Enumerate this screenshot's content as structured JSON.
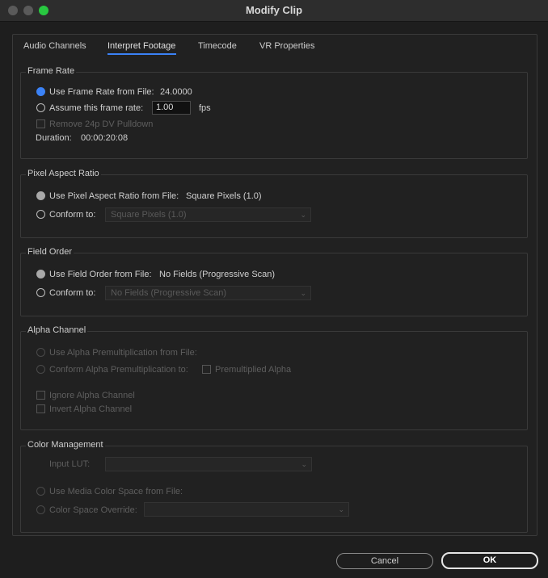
{
  "window": {
    "title": "Modify Clip"
  },
  "tabs": [
    "Audio Channels",
    "Interpret Footage",
    "Timecode",
    "VR Properties"
  ],
  "frame_rate": {
    "label": "Frame Rate",
    "use_from_file": "Use Frame Rate from File:",
    "file_value": "24.0000",
    "assume": "Assume this frame rate:",
    "assume_value": "1.00",
    "unit": "fps",
    "remove_pulldown": "Remove 24p DV Pulldown",
    "duration_label": "Duration:",
    "duration_value": "00:00:20:08"
  },
  "pixel_aspect": {
    "label": "Pixel Aspect Ratio",
    "use_from_file": "Use Pixel Aspect Ratio from File:",
    "file_value": "Square Pixels (1.0)",
    "conform": "Conform to:",
    "conform_value": "Square Pixels (1.0)"
  },
  "field_order": {
    "label": "Field Order",
    "use_from_file": "Use Field Order from File:",
    "file_value": "No Fields (Progressive Scan)",
    "conform": "Conform to:",
    "conform_value": "No Fields (Progressive Scan)"
  },
  "alpha": {
    "label": "Alpha Channel",
    "use_from_file": "Use Alpha Premultiplication from File:",
    "conform": "Conform Alpha Premultiplication to:",
    "premultiplied": "Premultiplied Alpha",
    "ignore": "Ignore Alpha Channel",
    "invert": "Invert Alpha Channel"
  },
  "color": {
    "label": "Color Management",
    "input_lut": "Input LUT:",
    "use_media": "Use Media Color Space from File:",
    "override": "Color Space Override:"
  },
  "buttons": {
    "cancel": "Cancel",
    "ok": "OK"
  }
}
